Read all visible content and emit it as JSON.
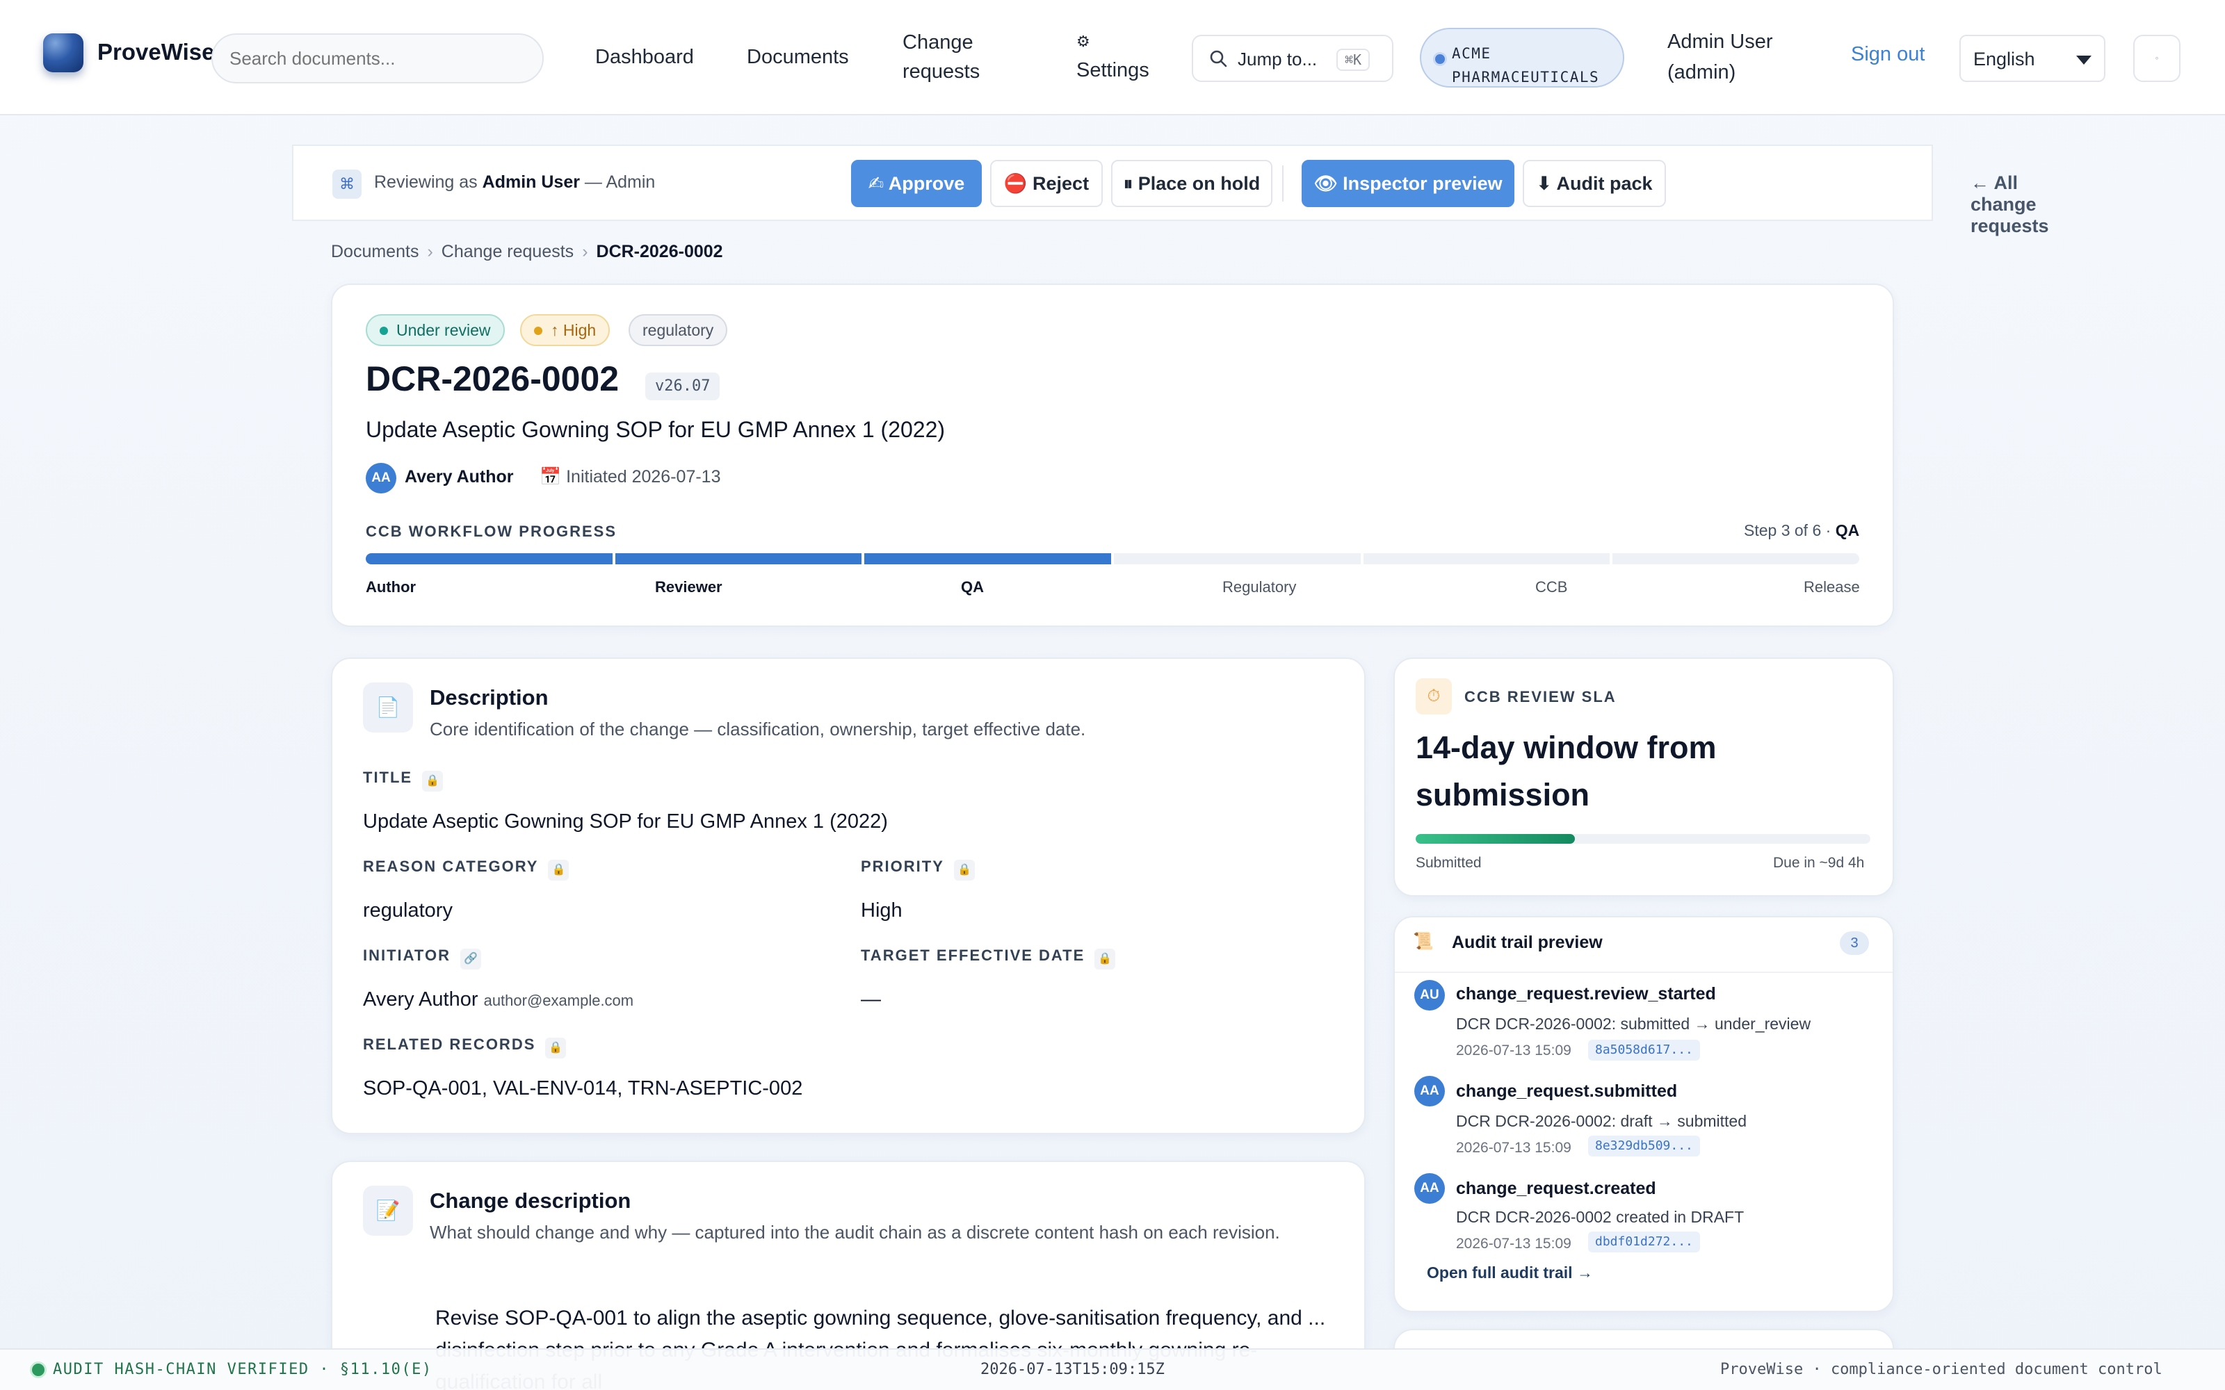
{
  "header": {
    "brand": "ProveWise",
    "search_placeholder": "Search documents...",
    "nav": {
      "dashboard": "Dashboard",
      "documents": "Documents",
      "change_requests_1": "Change",
      "change_requests_2": "requests",
      "settings_icon": "⚙",
      "settings": "Settings"
    },
    "jump_label": "Jump to...",
    "jump_kbd": "⌘K",
    "org_line1": "ACME",
    "org_line2": "PHARMACEUTICALS",
    "user_line1": "Admin User",
    "user_line2": "(admin)",
    "sign_out": "Sign out",
    "language": "English",
    "theme_glyph": "◦"
  },
  "review_bar": {
    "prefix": "Reviewing as",
    "user": "Admin User",
    "role_suffix": "— Admin",
    "approve": "✍ Approve",
    "reject": "⛔ Reject",
    "hold": "⏸ Place on hold",
    "inspector": "👁 Inspector preview",
    "audit_pack": "⬇ Audit pack",
    "back": "← All change requests"
  },
  "breadcrumb": {
    "a": "Documents",
    "b": "Change requests",
    "c": "DCR-2026-0002",
    "sep": "›"
  },
  "summary": {
    "status": "Under review",
    "priority": "↑ High",
    "category": "regulatory",
    "id": "DCR-2026-0002",
    "version": "v26.07",
    "title": "Update Aseptic Gowning SOP for EU GMP Annex 1 (2022)",
    "author_initials": "AA",
    "author": "Avery Author",
    "initiated": "Initiated 2026-07-13",
    "workflow_label": "CCB WORKFLOW PROGRESS",
    "step_text": "Step 3 of 6 ·",
    "step_role": "QA",
    "progress_completed_steps": 3,
    "progress_total_steps": 6,
    "stages": [
      "Author",
      "Reviewer",
      "QA",
      "Regulatory",
      "CCB",
      "Release"
    ]
  },
  "description": {
    "title": "Description",
    "subtitle": "Core identification of the change — classification, ownership, target effective date.",
    "title_label": "TITLE",
    "title_value": "Update Aseptic Gowning SOP for EU GMP Annex 1 (2022)",
    "reason_label": "REASON CATEGORY",
    "reason_value": "regulatory",
    "priority_label": "PRIORITY",
    "priority_value": "High",
    "initiator_label": "INITIATOR",
    "initiator_value": "Avery Author",
    "initiator_email": "author@example.com",
    "target_label": "TARGET EFFECTIVE DATE",
    "target_value": "—",
    "related_label": "RELATED RECORDS",
    "related_value": "SOP-QA-001, VAL-ENV-014, TRN-ASEPTIC-002"
  },
  "change_description": {
    "title": "Change description",
    "subtitle": "What should change and why — captured into the audit chain as a discrete content hash on each revision.",
    "body": "Revise SOP-QA-001 to align the aseptic gowning sequence, glove-sanitisation frequency, and ... disinfection step prior to any Grade A intervention and formalises six-monthly gowning re-qualification for all"
  },
  "sla": {
    "label": "CCB REVIEW SLA",
    "headline": "14-day window from submission",
    "progress_fraction": 0.35,
    "left": "Submitted",
    "right": "Due in ~9d 4h"
  },
  "audit": {
    "title": "Audit trail preview",
    "count": "3",
    "events": [
      {
        "initials": "AU",
        "name": "change_request.review_started",
        "detail": "DCR DCR-2026-0002: submitted → under_review",
        "time": "2026-07-13 15:09",
        "hash": "8a5058d617..."
      },
      {
        "initials": "AA",
        "name": "change_request.submitted",
        "detail": "DCR DCR-2026-0002: draft → submitted",
        "time": "2026-07-13 15:09",
        "hash": "8e329db509..."
      },
      {
        "initials": "AA",
        "name": "change_request.created",
        "detail": "DCR DCR-2026-0002 created in DRAFT",
        "time": "2026-07-13 15:09",
        "hash": "dbdf01d272..."
      }
    ],
    "open_link": "Open full audit trail →"
  },
  "footer": {
    "verified": "AUDIT HASH-CHAIN VERIFIED · §11.10(E)",
    "timestamp": "2026-07-13T15:09:15Z",
    "brand": "ProveWise · compliance-oriented document control"
  },
  "colors": {
    "accent": "#4d8ee0",
    "success": "#2c9a5f",
    "warning": "#e89a3a"
  }
}
